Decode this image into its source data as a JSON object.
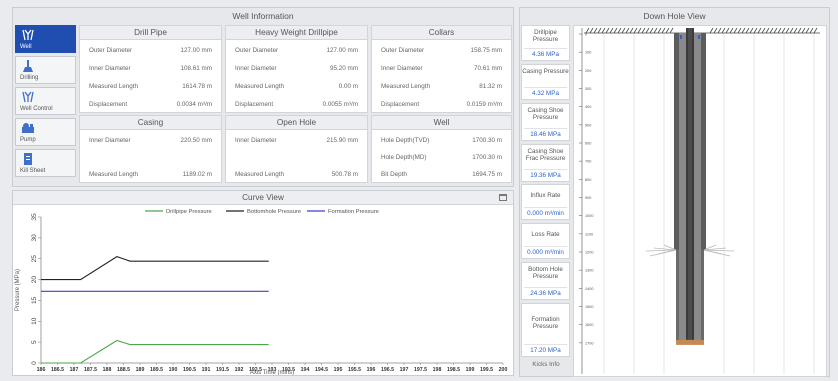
{
  "well_info": {
    "title": "Well Information",
    "sidebar": [
      {
        "label": "Well",
        "icon": "well-icon",
        "active": true
      },
      {
        "label": "Drilling",
        "icon": "drilling-icon",
        "active": false
      },
      {
        "label": "Well Control",
        "icon": "well-control-icon",
        "active": false
      },
      {
        "label": "Pump",
        "icon": "pump-icon",
        "active": false
      },
      {
        "label": "Kill Sheet",
        "icon": "kill-sheet-icon",
        "active": false
      }
    ],
    "panels": {
      "drill_pipe": {
        "title": "Drill Pipe",
        "rows": [
          {
            "k": "Outer Diameter",
            "v": "127.00 mm"
          },
          {
            "k": "Inner Diameter",
            "v": "108.61 mm"
          },
          {
            "k": "Measured Length",
            "v": "1614.78 m"
          },
          {
            "k": "Displacement",
            "v": "0.0034 m³/m"
          }
        ]
      },
      "hwdp": {
        "title": "Heavy Weight Drillpipe",
        "rows": [
          {
            "k": "Outer Diameter",
            "v": "127.00 mm"
          },
          {
            "k": "Inner Diameter",
            "v": "95.20 mm"
          },
          {
            "k": "Measured Length",
            "v": "0.00 m"
          },
          {
            "k": "Displacement",
            "v": "0.0055 m³/m"
          }
        ]
      },
      "collars": {
        "title": "Collars",
        "rows": [
          {
            "k": "Outer Diameter",
            "v": "158.75 mm"
          },
          {
            "k": "Inner Diameter",
            "v": "70.61 mm"
          },
          {
            "k": "Measured Length",
            "v": "81.32 m"
          },
          {
            "k": "Displacement",
            "v": "0.0159 m³/m"
          }
        ]
      },
      "casing": {
        "title": "Casing",
        "rows": [
          {
            "k": "Inner Diameter",
            "v": "220.50 mm"
          },
          {
            "k": "Measured Length",
            "v": "1189.02 m"
          }
        ]
      },
      "open_hole": {
        "title": "Open Hole",
        "rows": [
          {
            "k": "Inner Diameter",
            "v": "215.90 mm"
          },
          {
            "k": "Measured Length",
            "v": "500.78 m"
          }
        ]
      },
      "well": {
        "title": "Well",
        "rows": [
          {
            "k": "Hole Depth(TVD)",
            "v": "1700.30 m"
          },
          {
            "k": "Hole Depth(MD)",
            "v": "1700.30 m"
          },
          {
            "k": "Bit Depth",
            "v": "1694.75 m"
          }
        ]
      }
    }
  },
  "curve_view": {
    "title": "Curve View",
    "maximize_icon": "maximize-icon"
  },
  "chart_data": {
    "type": "line",
    "title": "",
    "xlabel": "Axis Time (mins)",
    "ylabel": "Pressure (MPa)",
    "xlim": [
      186,
      200
    ],
    "ylim": [
      0,
      35
    ],
    "x_ticks": [
      "186",
      "186.5",
      "187",
      "187.5",
      "188",
      "188.5",
      "189",
      "189.5",
      "190",
      "190.5",
      "191",
      "191.5",
      "192",
      "192.5",
      "193",
      "193.5",
      "194",
      "194.5",
      "195",
      "195.5",
      "196",
      "196.5",
      "197",
      "197.5",
      "198",
      "198.5",
      "199",
      "199.5",
      "200"
    ],
    "y_ticks": [
      "0",
      "5",
      "10",
      "15",
      "20",
      "25",
      "30",
      "35"
    ],
    "legend": "top",
    "series": [
      {
        "name": "Drillpipe Pressure",
        "color": "#4aa84a",
        "x": [
          186,
          187.2,
          188.3,
          188.7,
          192.9
        ],
        "y": [
          0,
          0,
          5.4,
          4.4,
          4.4
        ]
      },
      {
        "name": "Bottomhole Pressure",
        "color": "#222222",
        "x": [
          186,
          187.2,
          188.3,
          188.7,
          192.9
        ],
        "y": [
          20,
          20,
          25.5,
          24.4,
          24.4
        ]
      },
      {
        "name": "Formation Pressure",
        "color": "#3f3fd0",
        "x": [
          186,
          192.9
        ],
        "y": [
          17.2,
          17.2
        ]
      }
    ]
  },
  "down_hole": {
    "title": "Down Hole View",
    "metrics": [
      {
        "label": "Drillpipe Pressure",
        "value": "4.36 MPa"
      },
      {
        "label": "Casing Pressure",
        "value": "4.32 MPa"
      },
      {
        "label": "Casing Shoe Pressure",
        "value": "18.46 MPa"
      },
      {
        "label": "Casing Shoe Frac Pressure",
        "value": "19.36 MPa"
      },
      {
        "label": "Influx Rate",
        "value": "0.000 m³/min"
      },
      {
        "label": "Loss Rate",
        "value": "0.000 m³/min"
      },
      {
        "label": "Bottom Hole Pressure",
        "value": "24.36 MPa"
      },
      {
        "label": "Formation Pressure",
        "value": "17.20 MPa"
      }
    ],
    "kicks_label": "Kicks Info",
    "depth_ticks": [
      "0",
      "100",
      "200",
      "300",
      "400",
      "500",
      "600",
      "700",
      "800",
      "900",
      "1000",
      "1100",
      "1200",
      "1300",
      "1400",
      "1500",
      "1600",
      "1700"
    ],
    "depth_max": 1800
  }
}
